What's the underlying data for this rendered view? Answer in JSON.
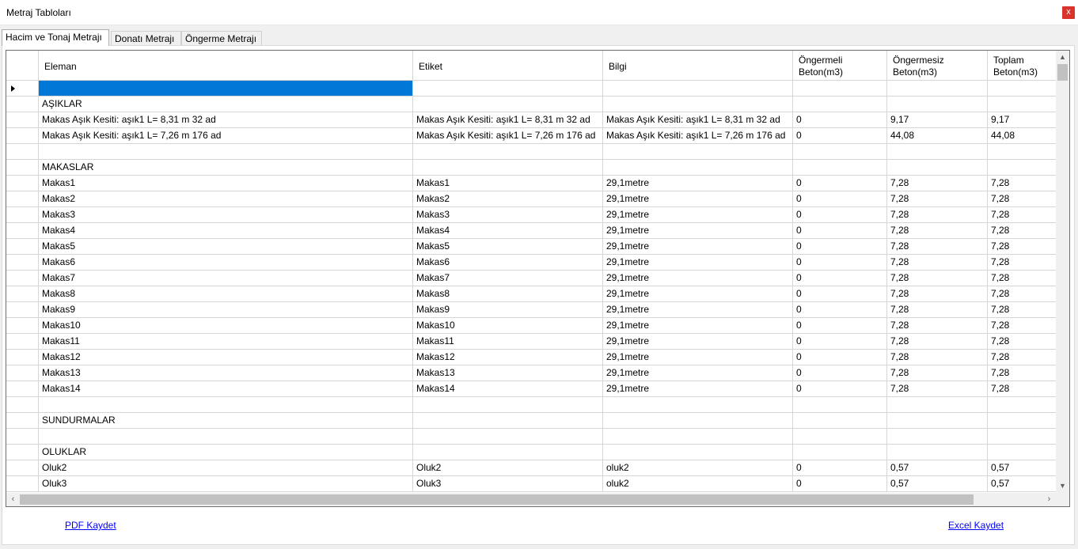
{
  "window": {
    "title": "Metraj Tabloları",
    "close_label": "x"
  },
  "tabs": [
    {
      "label": "Hacim ve Tonaj Metrajı",
      "active": true
    },
    {
      "label": "Donatı Metrajı",
      "active": false
    },
    {
      "label": "Öngerme Metrajı",
      "active": false
    }
  ],
  "grid": {
    "columns": [
      "Eleman",
      "Etiket",
      "Bilgi",
      "Öngermeli Beton(m3)",
      "Öngermesiz Beton(m3)",
      "Toplam Beton(m3)"
    ],
    "rows": [
      [
        "",
        "",
        "",
        "",
        "",
        ""
      ],
      [
        "AŞIKLAR",
        "",
        "",
        "",
        "",
        ""
      ],
      [
        "Makas Aşık Kesiti: aşık1  L= 8,31 m 32 ad",
        "Makas Aşık Kesiti: aşık1  L= 8,31 m 32 ad",
        "Makas Aşık Kesiti: aşık1  L= 8,31 m 32 ad",
        "0",
        "9,17",
        "9,17"
      ],
      [
        "Makas Aşık Kesiti: aşık1  L= 7,26 m 176 ad",
        "Makas Aşık Kesiti: aşık1  L= 7,26 m 176 ad",
        "Makas Aşık Kesiti: aşık1  L= 7,26 m 176 ad",
        "0",
        "44,08",
        "44,08"
      ],
      [
        "",
        "",
        "",
        "",
        "",
        ""
      ],
      [
        "MAKASLAR",
        "",
        "",
        "",
        "",
        ""
      ],
      [
        "Makas1",
        "Makas1",
        "29,1metre",
        "0",
        "7,28",
        "7,28"
      ],
      [
        "Makas2",
        "Makas2",
        "29,1metre",
        "0",
        "7,28",
        "7,28"
      ],
      [
        "Makas3",
        "Makas3",
        "29,1metre",
        "0",
        "7,28",
        "7,28"
      ],
      [
        "Makas4",
        "Makas4",
        "29,1metre",
        "0",
        "7,28",
        "7,28"
      ],
      [
        "Makas5",
        "Makas5",
        "29,1metre",
        "0",
        "7,28",
        "7,28"
      ],
      [
        "Makas6",
        "Makas6",
        "29,1metre",
        "0",
        "7,28",
        "7,28"
      ],
      [
        "Makas7",
        "Makas7",
        "29,1metre",
        "0",
        "7,28",
        "7,28"
      ],
      [
        "Makas8",
        "Makas8",
        "29,1metre",
        "0",
        "7,28",
        "7,28"
      ],
      [
        "Makas9",
        "Makas9",
        "29,1metre",
        "0",
        "7,28",
        "7,28"
      ],
      [
        "Makas10",
        "Makas10",
        "29,1metre",
        "0",
        "7,28",
        "7,28"
      ],
      [
        "Makas11",
        "Makas11",
        "29,1metre",
        "0",
        "7,28",
        "7,28"
      ],
      [
        "Makas12",
        "Makas12",
        "29,1metre",
        "0",
        "7,28",
        "7,28"
      ],
      [
        "Makas13",
        "Makas13",
        "29,1metre",
        "0",
        "7,28",
        "7,28"
      ],
      [
        "Makas14",
        "Makas14",
        "29,1metre",
        "0",
        "7,28",
        "7,28"
      ],
      [
        "",
        "",
        "",
        "",
        "",
        ""
      ],
      [
        "SUNDURMALAR",
        "",
        "",
        "",
        "",
        ""
      ],
      [
        "",
        "",
        "",
        "",
        "",
        ""
      ],
      [
        "OLUKLAR",
        "",
        "",
        "",
        "",
        ""
      ],
      [
        "Oluk2",
        "Oluk2",
        "oluk2",
        "0",
        "0,57",
        "0,57"
      ],
      [
        "Oluk3",
        "Oluk3",
        "oluk2",
        "0",
        "0,57",
        "0,57"
      ]
    ]
  },
  "footer": {
    "pdf_label": "PDF Kaydet",
    "excel_label": "Excel Kaydet"
  },
  "colors": {
    "selection": "#0078d7",
    "link": "#0000ff",
    "close": "#d9342b"
  }
}
